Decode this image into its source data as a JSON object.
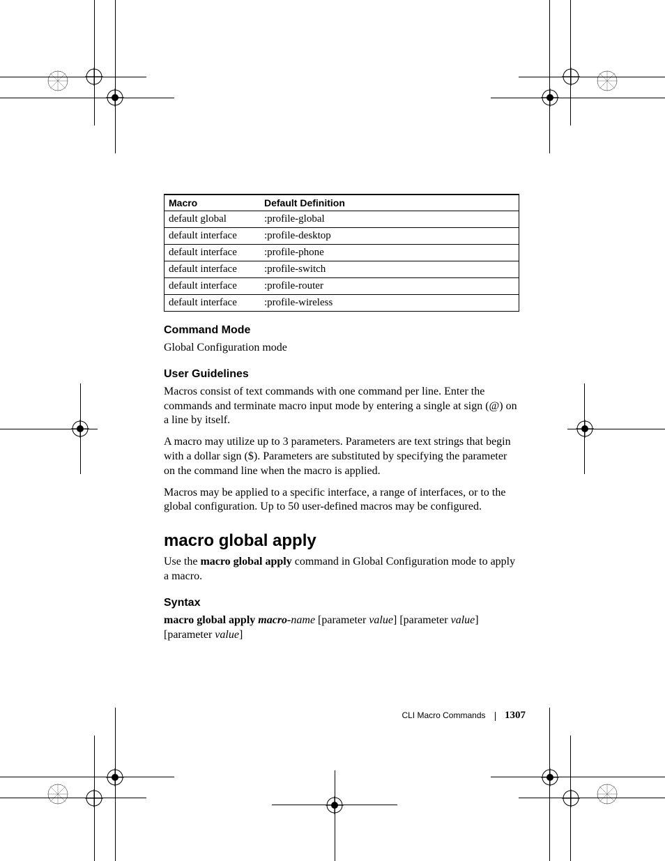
{
  "table": {
    "headers": [
      "Macro",
      "Default Definition"
    ],
    "rows": [
      [
        "default global",
        ":profile-global"
      ],
      [
        "default interface",
        ":profile-desktop"
      ],
      [
        "default interface",
        ":profile-phone"
      ],
      [
        "default interface",
        ":profile-switch"
      ],
      [
        "default interface",
        ":profile-router"
      ],
      [
        "default interface",
        ":profile-wireless"
      ]
    ]
  },
  "sections": {
    "command_mode_title": "Command Mode",
    "command_mode_text": "Global Configuration mode",
    "user_guidelines_title": "User Guidelines",
    "ug_p1": "Macros consist of text commands with one command per line. Enter the commands and terminate macro input mode by entering a single at sign (@) on a line by itself.",
    "ug_p2": "A macro may utilize up to 3 parameters. Parameters are text strings that begin with a dollar sign ($). Parameters are substituted by specifying the parameter on the command line when the macro is applied.",
    "ug_p3": "Macros may be applied to a specific interface, a range of interfaces, or to the global configuration. Up to 50 user-defined macros may be configured.",
    "heading": "macro global apply",
    "intro_pre": "Use the ",
    "intro_cmd": "macro global apply",
    "intro_post": " command in Global Configuration mode to apply a macro.",
    "syntax_title": "Syntax",
    "syntax_cmd": "macro global apply",
    "syntax_macro_word": " macro-",
    "syntax_name": "name",
    "syntax_param_open": " [parameter ",
    "syntax_value": "value",
    "syntax_close": "]",
    "syntax_param2_open": " [parameter ",
    "syntax_param3_open": "[parameter "
  },
  "footer": {
    "section": "CLI Macro Commands",
    "page": "1307"
  }
}
